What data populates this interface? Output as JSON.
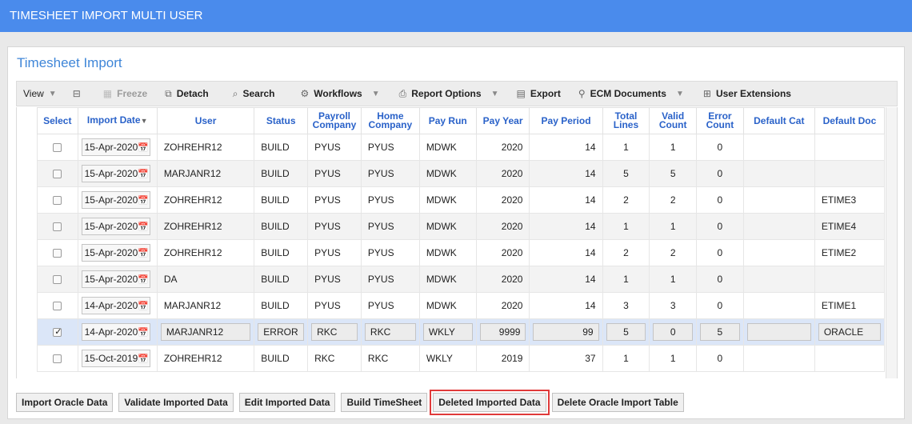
{
  "app": {
    "title": "TIMESHEET IMPORT MULTI USER"
  },
  "panel": {
    "title": "Timesheet Import"
  },
  "toolbar": {
    "view": "View",
    "freeze": "Freeze",
    "detach": "Detach",
    "search": "Search",
    "workflows": "Workflows",
    "report_options": "Report Options",
    "export": "Export",
    "ecm_documents": "ECM Documents",
    "user_extensions": "User Extensions"
  },
  "columns": {
    "select": "Select",
    "import_date": "Import Date",
    "user": "User",
    "status": "Status",
    "payroll_company": "Payroll Company",
    "home_company": "Home Company",
    "pay_run": "Pay Run",
    "pay_year": "Pay Year",
    "pay_period": "Pay Period",
    "total_lines": "Total Lines",
    "valid_count": "Valid Count",
    "error_count": "Error Count",
    "default_cat": "Default Cat",
    "default_doc": "Default Doc"
  },
  "rows": [
    {
      "checked": false,
      "import_date": "15-Apr-2020",
      "user": "ZOHREHR12",
      "status": "BUILD",
      "payroll_company": "PYUS",
      "home_company": "PYUS",
      "pay_run": "MDWK",
      "pay_year": "2020",
      "pay_period": "14",
      "total_lines": "1",
      "valid_count": "1",
      "error_count": "0",
      "default_cat": "",
      "default_doc": ""
    },
    {
      "checked": false,
      "import_date": "15-Apr-2020",
      "user": "MARJANR12",
      "status": "BUILD",
      "payroll_company": "PYUS",
      "home_company": "PYUS",
      "pay_run": "MDWK",
      "pay_year": "2020",
      "pay_period": "14",
      "total_lines": "5",
      "valid_count": "5",
      "error_count": "0",
      "default_cat": "",
      "default_doc": ""
    },
    {
      "checked": false,
      "import_date": "15-Apr-2020",
      "user": "ZOHREHR12",
      "status": "BUILD",
      "payroll_company": "PYUS",
      "home_company": "PYUS",
      "pay_run": "MDWK",
      "pay_year": "2020",
      "pay_period": "14",
      "total_lines": "2",
      "valid_count": "2",
      "error_count": "0",
      "default_cat": "",
      "default_doc": "ETIME3"
    },
    {
      "checked": false,
      "import_date": "15-Apr-2020",
      "user": "ZOHREHR12",
      "status": "BUILD",
      "payroll_company": "PYUS",
      "home_company": "PYUS",
      "pay_run": "MDWK",
      "pay_year": "2020",
      "pay_period": "14",
      "total_lines": "1",
      "valid_count": "1",
      "error_count": "0",
      "default_cat": "",
      "default_doc": "ETIME4"
    },
    {
      "checked": false,
      "import_date": "15-Apr-2020",
      "user": "ZOHREHR12",
      "status": "BUILD",
      "payroll_company": "PYUS",
      "home_company": "PYUS",
      "pay_run": "MDWK",
      "pay_year": "2020",
      "pay_period": "14",
      "total_lines": "2",
      "valid_count": "2",
      "error_count": "0",
      "default_cat": "",
      "default_doc": "ETIME2"
    },
    {
      "checked": false,
      "import_date": "15-Apr-2020",
      "user": "DA",
      "status": "BUILD",
      "payroll_company": "PYUS",
      "home_company": "PYUS",
      "pay_run": "MDWK",
      "pay_year": "2020",
      "pay_period": "14",
      "total_lines": "1",
      "valid_count": "1",
      "error_count": "0",
      "default_cat": "",
      "default_doc": ""
    },
    {
      "checked": false,
      "import_date": "14-Apr-2020",
      "user": "MARJANR12",
      "status": "BUILD",
      "payroll_company": "PYUS",
      "home_company": "PYUS",
      "pay_run": "MDWK",
      "pay_year": "2020",
      "pay_period": "14",
      "total_lines": "3",
      "valid_count": "3",
      "error_count": "0",
      "default_cat": "",
      "default_doc": "ETIME1"
    },
    {
      "checked": true,
      "import_date": "14-Apr-2020",
      "user": "MARJANR12",
      "status": "ERROR",
      "payroll_company": "RKC",
      "home_company": "RKC",
      "pay_run": "WKLY",
      "pay_year": "9999",
      "pay_period": "99",
      "total_lines": "5",
      "valid_count": "0",
      "error_count": "5",
      "default_cat": "",
      "default_doc": "ORACLE"
    },
    {
      "checked": false,
      "import_date": "15-Oct-2019",
      "user": "ZOHREHR12",
      "status": "BUILD",
      "payroll_company": "RKC",
      "home_company": "RKC",
      "pay_run": "WKLY",
      "pay_year": "2019",
      "pay_period": "37",
      "total_lines": "1",
      "valid_count": "1",
      "error_count": "0",
      "default_cat": "",
      "default_doc": ""
    }
  ],
  "buttons": {
    "import_oracle": "Import Oracle Data",
    "validate": "Validate Imported Data",
    "edit": "Edit Imported Data",
    "build": "Build TimeSheet",
    "deleted": "Deleted Imported Data",
    "delete_table": "Delete Oracle Import Table"
  },
  "colors": {
    "accent": "#4a8bec",
    "highlight": "#e03a3a",
    "header_text": "#2a62c9"
  }
}
